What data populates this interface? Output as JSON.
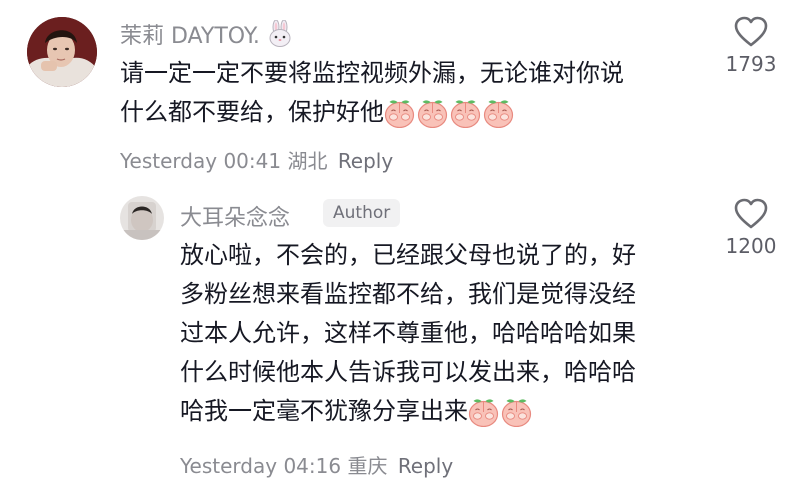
{
  "comments": [
    {
      "username": "茉莉 DAYTOY.",
      "username_emoji": "rabbit-icon",
      "text_lines": [
        "请一定一定不要将监控视频外漏，无论谁对你说",
        "什么都不要给，保护好他"
      ],
      "trailing_emojis": [
        "peach-cover-face-emoji",
        "peach-cover-face-emoji",
        "peach-cover-face-emoji",
        "peach-cover-face-emoji"
      ],
      "time": "Yesterday 00:41",
      "location": "湖北",
      "reply_label": "Reply",
      "likes": "1793"
    },
    {
      "username": "大耳朵念念",
      "badge": "Author",
      "text_lines": [
        "放心啦，不会的，已经跟父母也说了的，好",
        "多粉丝想来看监控都不给，我们是觉得没经",
        "过本人允许，这样不尊重他，哈哈哈哈如果",
        "什么时候他本人告诉我可以发出来，哈哈哈",
        "哈我一定毫不犹豫分享出来"
      ],
      "trailing_emojis": [
        "peach-cover-face-emoji",
        "peach-cover-face-emoji"
      ],
      "time": "Yesterday 04:16",
      "location": "重庆",
      "reply_label": "Reply",
      "likes": "1200"
    }
  ],
  "colors": {
    "text": "#161823",
    "secondary": "#8a8b91",
    "badge_bg": "#f1f1f2",
    "peach": "#f7b0a8",
    "peach_leaf": "#5dbb63"
  }
}
